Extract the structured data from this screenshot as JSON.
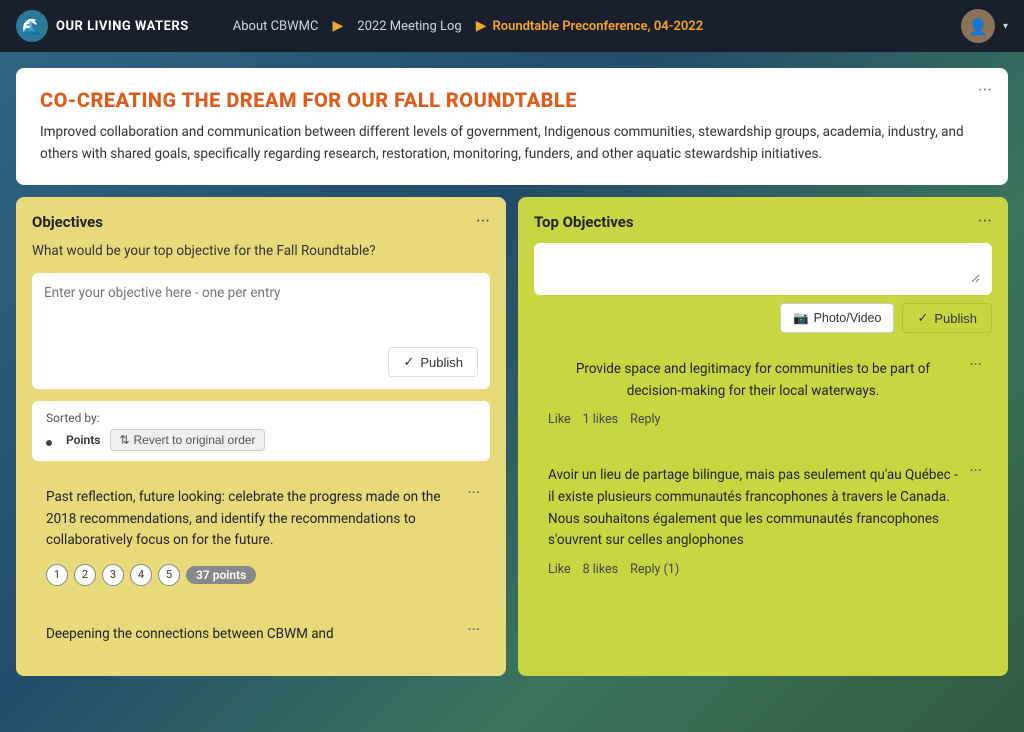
{
  "nav": {
    "logo_text": "OUR LIVING WATERS",
    "logo_icon": "🌊",
    "link1": "About CBWMC",
    "link2": "2022 Meeting Log",
    "link3": "Roundtable Preconference, 04-2022",
    "arrow": "▶",
    "menu_dots": "···",
    "chevron": "▾"
  },
  "header": {
    "title": "CO-CREATING THE DREAM FOR OUR FALL ROUNDTABLE",
    "description": "Improved collaboration and communication between different levels of government, Indigenous communities, stewardship groups, academia, industry, and others with shared goals, specifically regarding research, restoration, monitoring, funders, and other aquatic stewardship initiatives.",
    "menu_dots": "···"
  },
  "left_panel": {
    "title": "Objectives",
    "menu_dots": "···",
    "question": "What would be your top objective for the Fall Roundtable?",
    "input_placeholder": "Enter your objective here - one per entry",
    "publish_label": "Publish",
    "publish_check": "✓",
    "sorted_label": "Sorted by:",
    "sorted_point": "Points",
    "revert_label": "Revert to original order",
    "revert_icon": "⇅",
    "post1_text": "Past reflection, future looking: celebrate the progress made on the 2018 recommendations, and identify the recommendations to collaboratively focus on for the future.",
    "post1_points": "37 points",
    "post1_circles": [
      "1",
      "2",
      "3",
      "4",
      "5"
    ],
    "post1_menu": "···",
    "post2_partial": "Deepening the connections between CBWM and",
    "post2_menu": "···"
  },
  "right_panel": {
    "title": "Top Objectives",
    "menu_dots": "···",
    "photo_label": "Photo/Video",
    "photo_icon": "📷",
    "publish_label": "Publish",
    "publish_check": "✓",
    "post1_text": "Provide space and legitimacy for communities to be part of decision-making for their local waterways.",
    "post1_menu": "···",
    "post1_like": "Like",
    "post1_likes_count": "1 likes",
    "post1_reply": "Reply",
    "post2_text": "Avoir un lieu de partage bilingue, mais pas seulement qu'au Québec - il existe plusieurs communautés francophones à travers le Canada. Nous souhaitons également que les communautés francophones s'ouvrent sur celles anglophones",
    "post2_menu": "···",
    "post2_like": "Like",
    "post2_likes_count": "8 likes",
    "post2_reply": "Reply (1)"
  }
}
